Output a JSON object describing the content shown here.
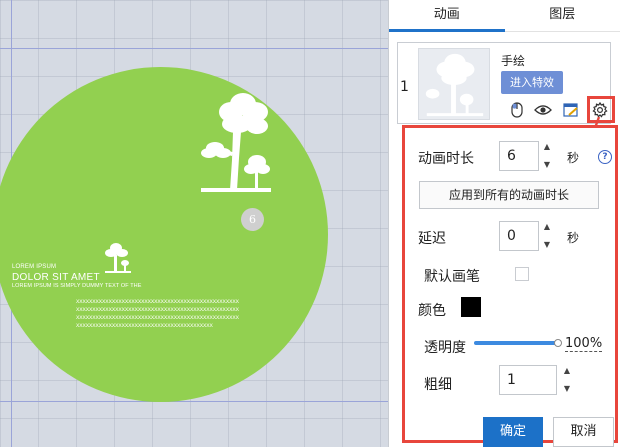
{
  "tabs": [
    {
      "label": "动画",
      "active": true
    },
    {
      "label": "图层",
      "active": false
    }
  ],
  "animation_item": {
    "index": "1",
    "name": "手绘",
    "enter_effect_label": "进入特效",
    "icons": [
      "mouse-icon",
      "eye-icon",
      "edit-window-icon",
      "gear-icon"
    ]
  },
  "settings": {
    "duration": {
      "label": "动画时长",
      "value": "6",
      "unit": "秒",
      "help": "?"
    },
    "apply_all_label": "应用到所有的动画时长",
    "delay": {
      "label": "延迟",
      "value": "0",
      "unit": "秒"
    },
    "default_pen": {
      "label": "默认画笔",
      "checked": false
    },
    "color": {
      "label": "颜色",
      "value": "#000000"
    },
    "opacity": {
      "label": "透明度",
      "value": "100%",
      "fraction": 1.0
    },
    "thickness": {
      "label": "粗细",
      "value": "1"
    },
    "ok_label": "确定",
    "cancel_label": "取消"
  },
  "canvas": {
    "badge": "6",
    "lorem_small": "LOREM IPSUM",
    "lorem_title": "DOLOR SIT AMET",
    "lorem_sub": "LOREM IPSUM IS SIMPLY DUMMY TEXT OF THE",
    "x_lines": [
      "XXXXXXXXXXXXXXXXXXXXXXXXXXXXXXXXXXXXXXXXXXXXXXXXXX",
      "XXXXXXXXXXXXXXXXXXXXXXXXXXXXXXXXXXXXXXXXXXXXXXXXXX",
      "XXXXXXXXXXXXXXXXXXXXXXXXXXXXXXXXXXXXXXXXXXXXXXXXXX",
      "XXXXXXXXXXXXXXXXXXXXXXXXXXXXXXXXXXXXXXXXXX"
    ],
    "disc_color": "#92d050"
  },
  "colors": {
    "accent": "#1c71c8",
    "highlight_red": "#e8463c",
    "enter_button": "#6e8fd6"
  }
}
